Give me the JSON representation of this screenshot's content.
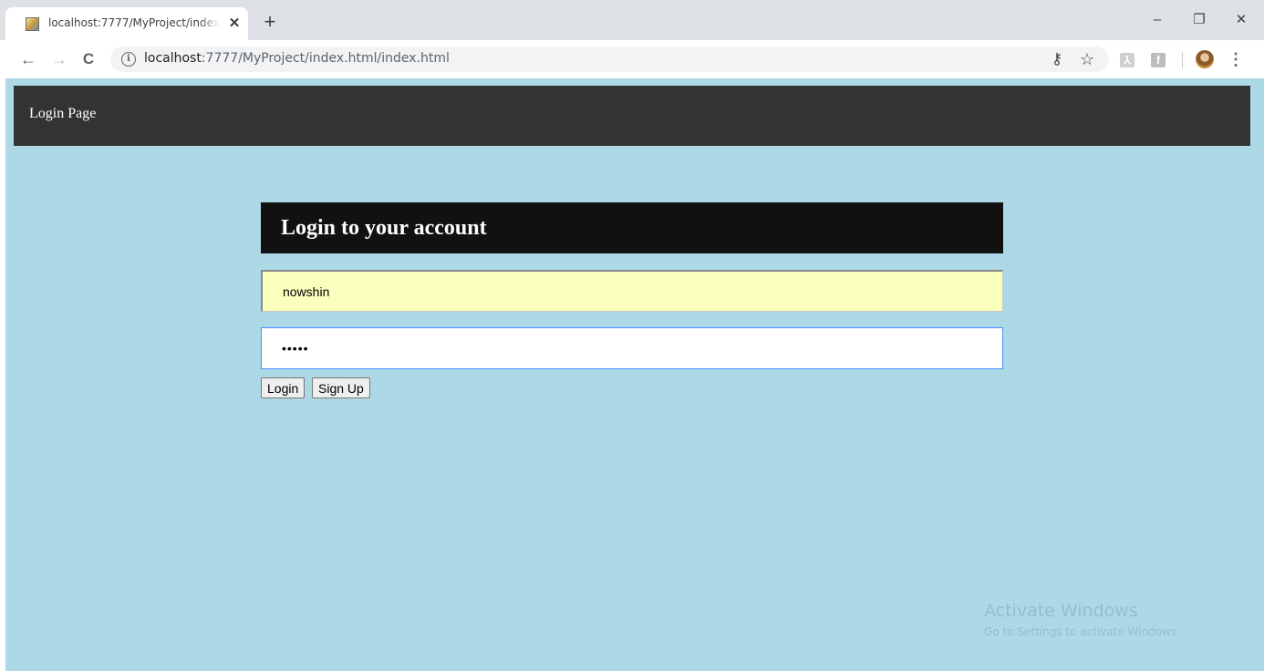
{
  "browser": {
    "tab_title": "localhost:7777/MyProject/index.html/index.html",
    "tab_close": "✕",
    "new_tab": "+",
    "window_controls": {
      "minimize": "–",
      "restore": "❐",
      "close": "✕"
    },
    "nav": {
      "back": "←",
      "forward": "→",
      "reload": "C"
    },
    "address": {
      "host": "localhost",
      "rest": ":7777/MyProject/index.html/index.html"
    },
    "icons": [
      "info-icon",
      "key-icon",
      "star-icon",
      "pdf-extension-icon",
      "facebook-extension-icon",
      "profile-avatar-icon",
      "menu-kebab-icon"
    ],
    "glyphs": {
      "info": "i",
      "key": "⚷",
      "star": "☆",
      "pdf": "⅄",
      "facebook": "f",
      "menu": "⋮"
    }
  },
  "page": {
    "nav_title": "Login Page",
    "panel_title": "Login to your account",
    "username_value": "nowshin",
    "password_value": "•••••",
    "login_button": "Login",
    "signup_button": "Sign Up",
    "colors": {
      "background": "#add8e6",
      "nav_bar": "#333333",
      "panel_header": "#111111",
      "autofill": "#faffbd",
      "focus_border": "#4d90fe"
    }
  },
  "os_watermark": {
    "title": "Activate Windows",
    "subtitle": "Go to Settings to activate Windows."
  }
}
